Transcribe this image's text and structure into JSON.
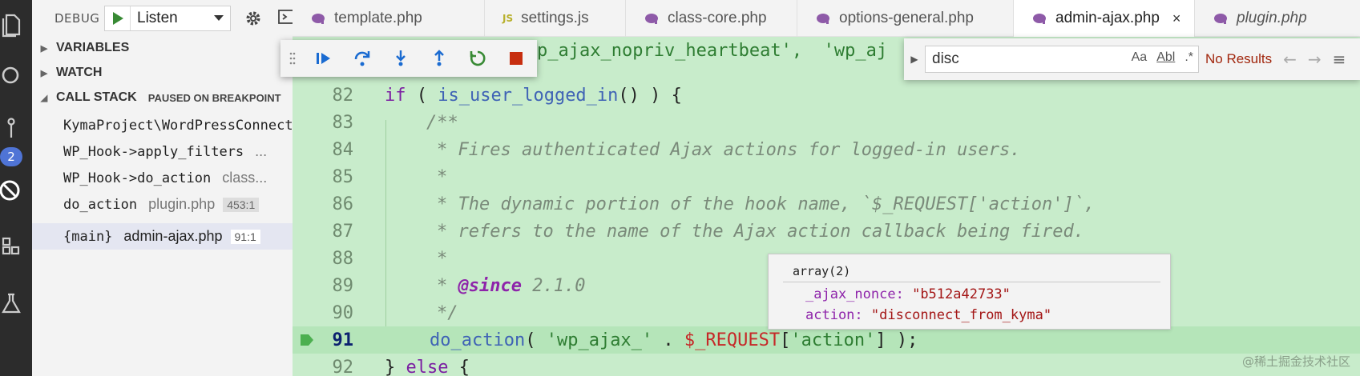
{
  "debug": {
    "label": "DEBUG",
    "config": "Listen",
    "sections": {
      "variables": "VARIABLES",
      "watch": "WATCH",
      "call_stack": "CALL STACK",
      "paused": "PAUSED ON BREAKPOINT"
    },
    "frames": [
      {
        "fn": "KymaProject\\WordPressConnector",
        "file": "",
        "line": ""
      },
      {
        "fn": "WP_Hook->apply_filters",
        "file": "...",
        "line": ""
      },
      {
        "fn": "WP_Hook->do_action",
        "file": "class...",
        "line": ""
      },
      {
        "fn": "do_action",
        "file": "plugin.php",
        "line": "453:1"
      },
      {
        "fn": "{main}",
        "file": "admin-ajax.php",
        "line": "91:1"
      }
    ],
    "badge_count": "2"
  },
  "tabs": [
    {
      "label": "template.php",
      "icon": "php-elephant-icon"
    },
    {
      "label": "settings.js",
      "icon": "js-icon",
      "badge": "JS"
    },
    {
      "label": "class-core.php",
      "icon": "php-elephant-icon"
    },
    {
      "label": "options-general.php",
      "icon": "php-elephant-icon"
    },
    {
      "label": "admin-ajax.php",
      "icon": "php-elephant-icon",
      "close": "×"
    },
    {
      "label": "plugin.php",
      "icon": "php-elephant-icon"
    }
  ],
  "find": {
    "value": "disc",
    "opt_case": "Aa",
    "opt_word": "Abl",
    "opt_regex": ".*",
    "status": "No Results"
  },
  "code": {
    "top_partial": "p_ajax_nopriv_heartbeat',  'wp_aj",
    "lines": [
      {
        "n": "82"
      },
      {
        "n": "83",
        "text": "/**"
      },
      {
        "n": "84",
        "text": "* Fires authenticated Ajax actions for logged-in users."
      },
      {
        "n": "85",
        "text": "*"
      },
      {
        "n": "86",
        "text": "* The dynamic portion of the hook name, `$_REQUEST['action']`,"
      },
      {
        "n": "87",
        "text": "* refers to the name of the Ajax action callback being fired."
      },
      {
        "n": "88",
        "text": "*"
      },
      {
        "n": "89",
        "star": "* ",
        "tag": "@since",
        "ver": " 2.1.0"
      },
      {
        "n": "90",
        "text": "*/"
      },
      {
        "n": "91"
      },
      {
        "n": "92"
      }
    ],
    "tokens": {
      "if": "if",
      "open_paren": " ( ",
      "is_user_logged_in": "is_user_logged_in",
      "call_close": "() ) {",
      "do_action": "do_action",
      "paren_open": "( ",
      "wp_ajax": "'wp_ajax_'",
      "dot": " . ",
      "request": "$_REQUEST",
      "bracket_open": "[",
      "action_str": "'action'",
      "end": "] );",
      "brace_close": "} ",
      "else": "else",
      "brace_open": " {"
    }
  },
  "hover": {
    "title": "array(2)",
    "rows": [
      {
        "key": "_ajax_nonce:",
        "value": "\"b512a42733\""
      },
      {
        "key": "action:",
        "value": "\"disconnect_from_kyma\""
      }
    ]
  },
  "watermark": "@稀土掘金技术社区"
}
